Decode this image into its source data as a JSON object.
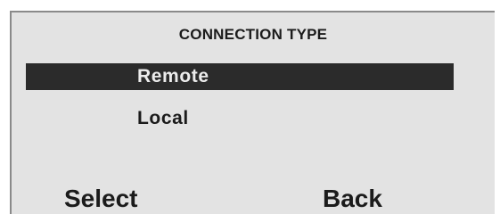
{
  "screen": {
    "title": "CONNECTION TYPE",
    "menu": [
      {
        "label": "Remote",
        "selected": true
      },
      {
        "label": "Local",
        "selected": false
      }
    ],
    "softkeys": {
      "left": "Select",
      "right": "Back"
    }
  },
  "colors": {
    "screen_background": "#e3e3e3",
    "highlight_background": "#2b2b2b",
    "highlight_text": "#ececec",
    "text": "#1b1b1b"
  }
}
